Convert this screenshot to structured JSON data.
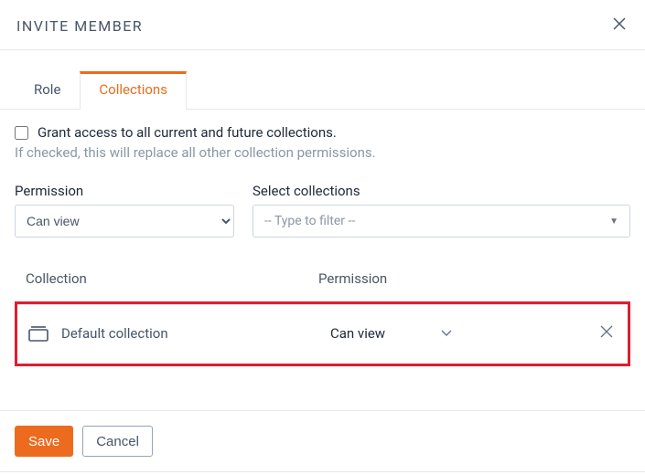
{
  "header": {
    "title": "INVITE MEMBER"
  },
  "tabs": {
    "role": "Role",
    "collections": "Collections"
  },
  "grant": {
    "label": "Grant access to all current and future collections.",
    "helper": "If checked, this will replace all other collection permissions."
  },
  "fields": {
    "permission_label": "Permission",
    "permission_value": "Can view",
    "select_collections_label": "Select collections",
    "filter_placeholder": "-- Type to filter --"
  },
  "table": {
    "col_collection": "Collection",
    "col_permission": "Permission",
    "rows": [
      {
        "name": "Default collection",
        "permission": "Can view"
      }
    ]
  },
  "footer": {
    "save": "Save",
    "cancel": "Cancel"
  }
}
